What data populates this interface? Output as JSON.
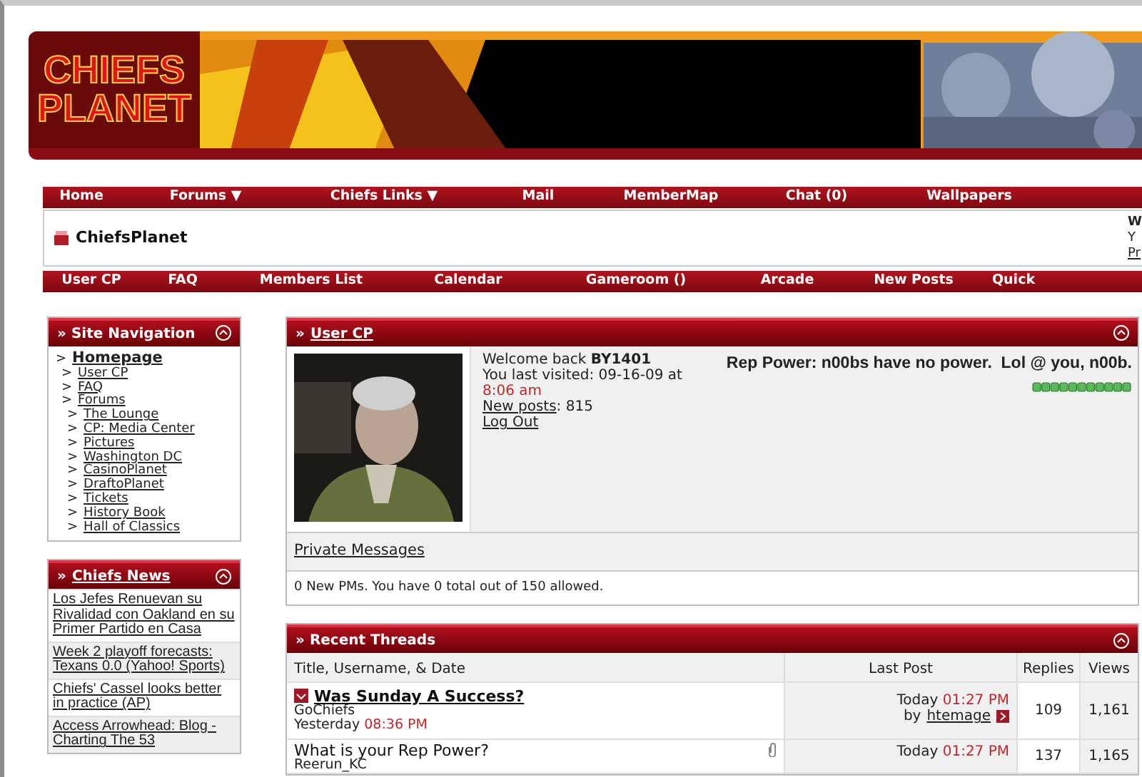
{
  "logo": {
    "line_1": "CHIEFS",
    "line_2": "PLANET"
  },
  "top_nav": [
    "Home",
    "Forums ▼",
    "Chiefs Links ▼",
    "Mail",
    "MemberMap",
    "Chat (0)",
    "Wallpapers"
  ],
  "site_title": "ChiefsPlanet",
  "welcome_cut": [
    "W",
    "Y",
    "Pr"
  ],
  "sub_nav": [
    "User CP",
    "FAQ",
    "Members List",
    "Calendar",
    "Gameroom ()",
    "Arcade",
    "New Posts",
    "Quick"
  ],
  "site_navigation": {
    "marker": "»",
    "title": "Site Navigation",
    "items": [
      {
        "bullet": ">",
        "label": "Homepage",
        "children": [
          {
            "bullet": ">",
            "label": "User CP"
          },
          {
            "bullet": ">",
            "label": "FAQ"
          },
          {
            "bullet": ">",
            "label": "Forums",
            "children": [
              {
                "bullet": ">",
                "label": "The Lounge"
              },
              {
                "bullet": ">",
                "label": "CP: Media Center"
              },
              {
                "bullet": ">",
                "label": "Pictures"
              },
              {
                "bullet": ">",
                "label": "Washington DC"
              },
              {
                "bullet": ">",
                "label": "CasinoPlanet"
              },
              {
                "bullet": ">",
                "label": "DraftoPlanet"
              },
              {
                "bullet": ">",
                "label": "Tickets"
              },
              {
                "bullet": ">",
                "label": "History Book"
              },
              {
                "bullet": ">",
                "label": "Hall of Classics"
              }
            ]
          }
        ]
      }
    ]
  },
  "chiefs_news": {
    "marker": "»",
    "title": "Chiefs News",
    "items": [
      "Los Jefes Renuevan su Rivalidad con Oakland en su Primer Partido en Casa",
      "Week 2 playoff forecasts: Texans 0.0 (Yahoo! Sports)",
      "Chiefs' Cassel looks better in practice (AP)",
      "Access Arrowhead: Blog - Charting The 53"
    ]
  },
  "user_cp": {
    "marker": "»",
    "title": "User CP",
    "welcome": "Welcome back",
    "username": "BY1401",
    "last_visited": "You last visited: 09-16-09 at",
    "last_visited_time": "8:06 am",
    "new_posts_label": "New posts",
    "new_posts": ": 815",
    "log_out": "Log Out",
    "rep_power": "Rep Power: n00bs have no power.  Lol @ you, n00b.",
    "private_messages": "Private Messages",
    "pm_status": "0 New PMs. You have 0 total out of 150 allowed."
  },
  "recent_threads": {
    "marker": "»",
    "title": "Recent Threads",
    "columns": [
      "Title, Username, & Date",
      "Last Post",
      "Replies",
      "Views"
    ],
    "rows": [
      {
        "title": "Was Sunday A Success?",
        "new": true,
        "attachment": false,
        "author": "GoChiefs",
        "date": "Yesterday",
        "time": "08:36 PM",
        "last_date": "Today",
        "last_time": "01:27 PM",
        "last_by": "by",
        "last_user": "htemage",
        "replies": "109",
        "views": "1,161"
      },
      {
        "title": "What is your Rep Power?",
        "new": false,
        "attachment": true,
        "author": "Reerun_KC",
        "last_date": "Today",
        "last_time": "01:27 PM",
        "replies": "137",
        "views": "1,165"
      }
    ]
  }
}
